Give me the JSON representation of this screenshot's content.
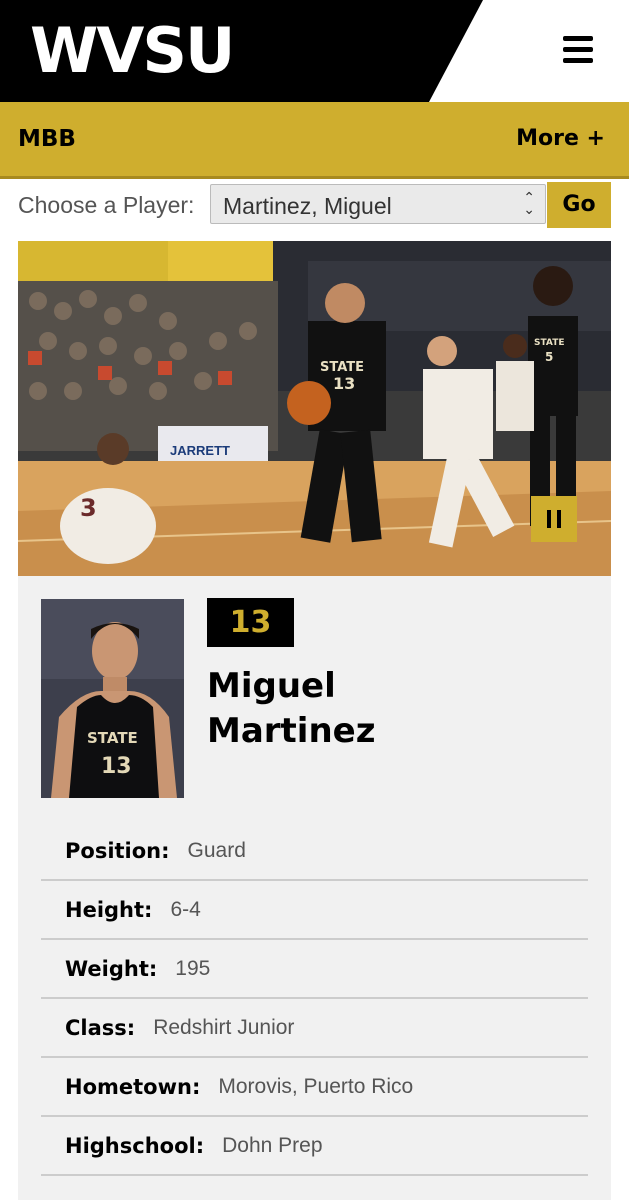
{
  "header": {
    "logo_text": "WVSU",
    "menu_icon": "hamburger-menu-icon",
    "brand_gold": "#cfae2e",
    "brand_black": "#000000"
  },
  "subnav": {
    "sport": "MBB",
    "more": "More +"
  },
  "chooser": {
    "label": "Choose a Player:",
    "selected": "Martinez, Miguel",
    "go": "Go"
  },
  "hero": {
    "pause_icon": "pause-icon",
    "banner_text": "JARRETT"
  },
  "player": {
    "number": "13",
    "first_name": "Miguel",
    "last_name": "Martinez",
    "jersey_text": "STATE",
    "bio": [
      {
        "label": "Position:",
        "value": "Guard"
      },
      {
        "label": "Height:",
        "value": "6-4"
      },
      {
        "label": "Weight:",
        "value": "195"
      },
      {
        "label": "Class:",
        "value": "Redshirt Junior"
      },
      {
        "label": "Hometown:",
        "value": "Morovis, Puerto Rico"
      },
      {
        "label": "Highschool:",
        "value": "Dohn Prep"
      }
    ]
  }
}
